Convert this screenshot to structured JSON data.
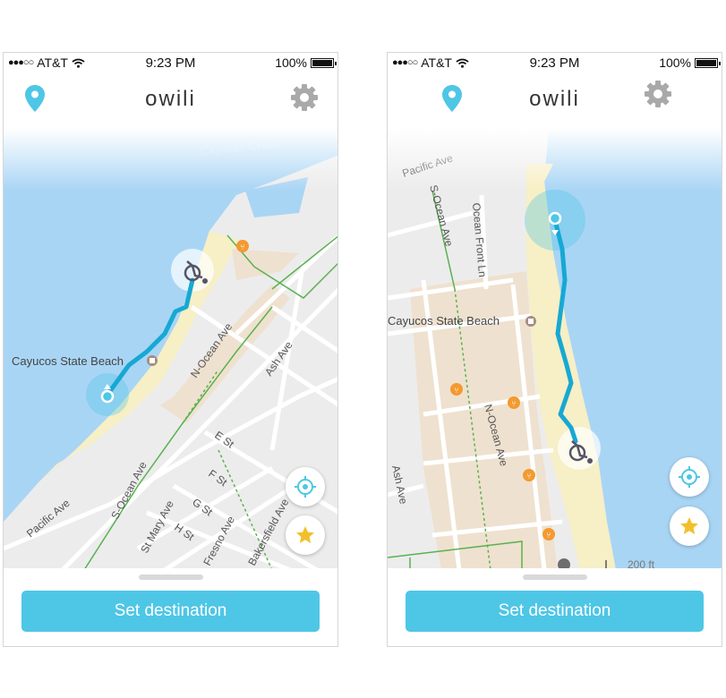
{
  "colors": {
    "accent": "#4ec6e6",
    "route": "#17a8d4",
    "water": "#a9d5f5",
    "beach": "#f7efc5",
    "land": "#ececec",
    "block": "#efe1cf",
    "road": "#ffffff",
    "path": "#58b24f",
    "poi": "#f39a30",
    "star": "#f2c02c"
  },
  "screens": [
    {
      "status": {
        "carrier": "AT&T",
        "time": "9:23 PM",
        "battery": "100%"
      },
      "app_title": "owili",
      "icons": {
        "left": "location-pin-icon",
        "right": "gear-icon"
      },
      "map_labels": {
        "creek": "Cayucos Creek",
        "beach": "Cayucos State Beach",
        "n_ocean": "N-Ocean Ave",
        "ash": "Ash Ave",
        "e_st": "E St",
        "f_st": "F St",
        "g_st": "G St",
        "h_st": "H St",
        "s_ocean": "S-Ocean Ave",
        "pacific": "Pacific Ave",
        "st_mary": "St Mary Ave",
        "fresno": "Fresno Ave",
        "bakersfield": "Bakersfield Ave"
      },
      "cta": "Set destination"
    },
    {
      "status": {
        "carrier": "AT&T",
        "time": "9:23 PM",
        "battery": "100%"
      },
      "app_title": "owili",
      "icons": {
        "left": "location-pin-icon",
        "right": "gear-icon"
      },
      "map_labels": {
        "pacific": "Pacific Ave",
        "s_ocean": "S-Ocean Ave",
        "ocean_front": "Ocean Front Ln",
        "beach": "Cayucos State Beach",
        "n_ocean": "N-Ocean Ave",
        "ash": "Ash Ave",
        "scale": "200 ft"
      },
      "cta": "Set destination"
    }
  ]
}
